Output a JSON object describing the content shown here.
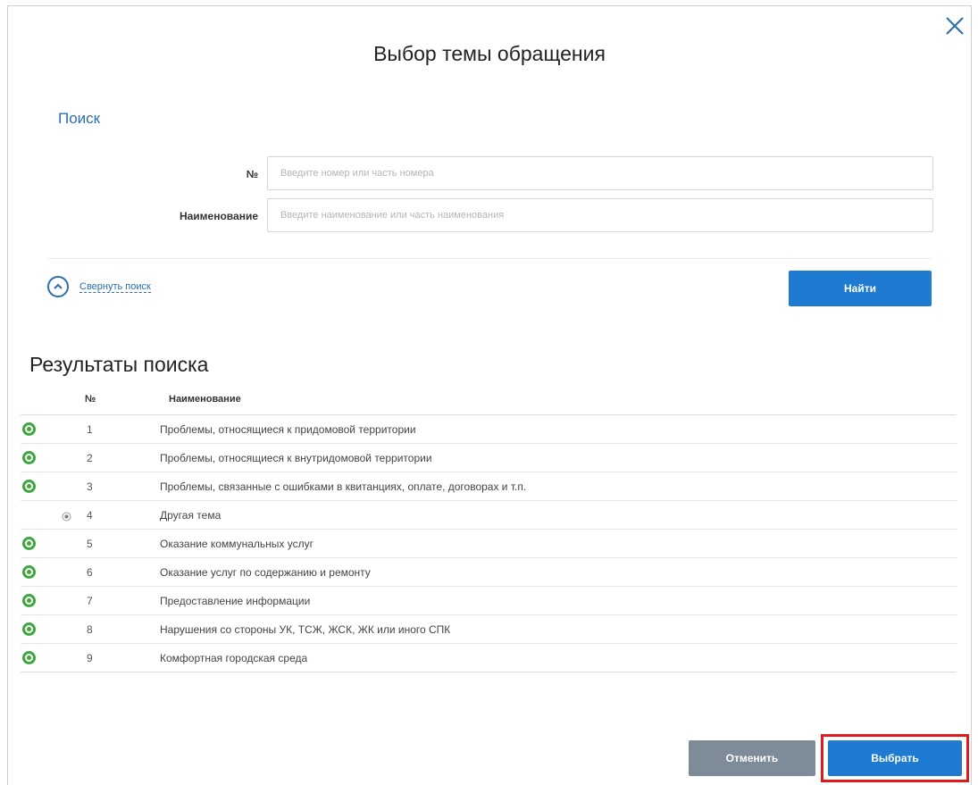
{
  "dialog": {
    "title": "Выбор темы обращения",
    "close_icon": "close-icon",
    "accent_color": "#1e7bd1",
    "highlight_color": "#e01b1b"
  },
  "search": {
    "header": "Поиск",
    "number_label": "№",
    "number_value": "",
    "number_placeholder": "Введите номер или часть номера",
    "name_label": "Наименование",
    "name_value": "",
    "name_placeholder": "Введите наименование или часть наименования",
    "collapse_label": "Свернуть поиск",
    "find_label": "Найти"
  },
  "results": {
    "title": "Результаты поиска",
    "columns": [
      "№",
      "Наименование"
    ],
    "rows": [
      {
        "num": "1",
        "name": "Проблемы, относящиеся к придомовой территории",
        "marker": "expand"
      },
      {
        "num": "2",
        "name": "Проблемы, относящиеся к внутридомовой территории",
        "marker": "expand"
      },
      {
        "num": "3",
        "name": "Проблемы, связанные с ошибками в квитанциях, оплате, договорах и т.п.",
        "marker": "expand"
      },
      {
        "num": "4",
        "name": "Другая тема",
        "marker": "radio"
      },
      {
        "num": "5",
        "name": "Оказание коммунальных услуг",
        "marker": "expand"
      },
      {
        "num": "6",
        "name": "Оказание услуг по содержанию и ремонту",
        "marker": "expand"
      },
      {
        "num": "7",
        "name": "Предоставление информации",
        "marker": "expand"
      },
      {
        "num": "8",
        "name": "Нарушения со стороны УК, ТСЖ, ЖСК, ЖК или иного СПК",
        "marker": "expand"
      },
      {
        "num": "9",
        "name": "Комфортная городская среда",
        "marker": "expand"
      }
    ]
  },
  "footer": {
    "cancel_label": "Отменить",
    "select_label": "Выбрать"
  }
}
